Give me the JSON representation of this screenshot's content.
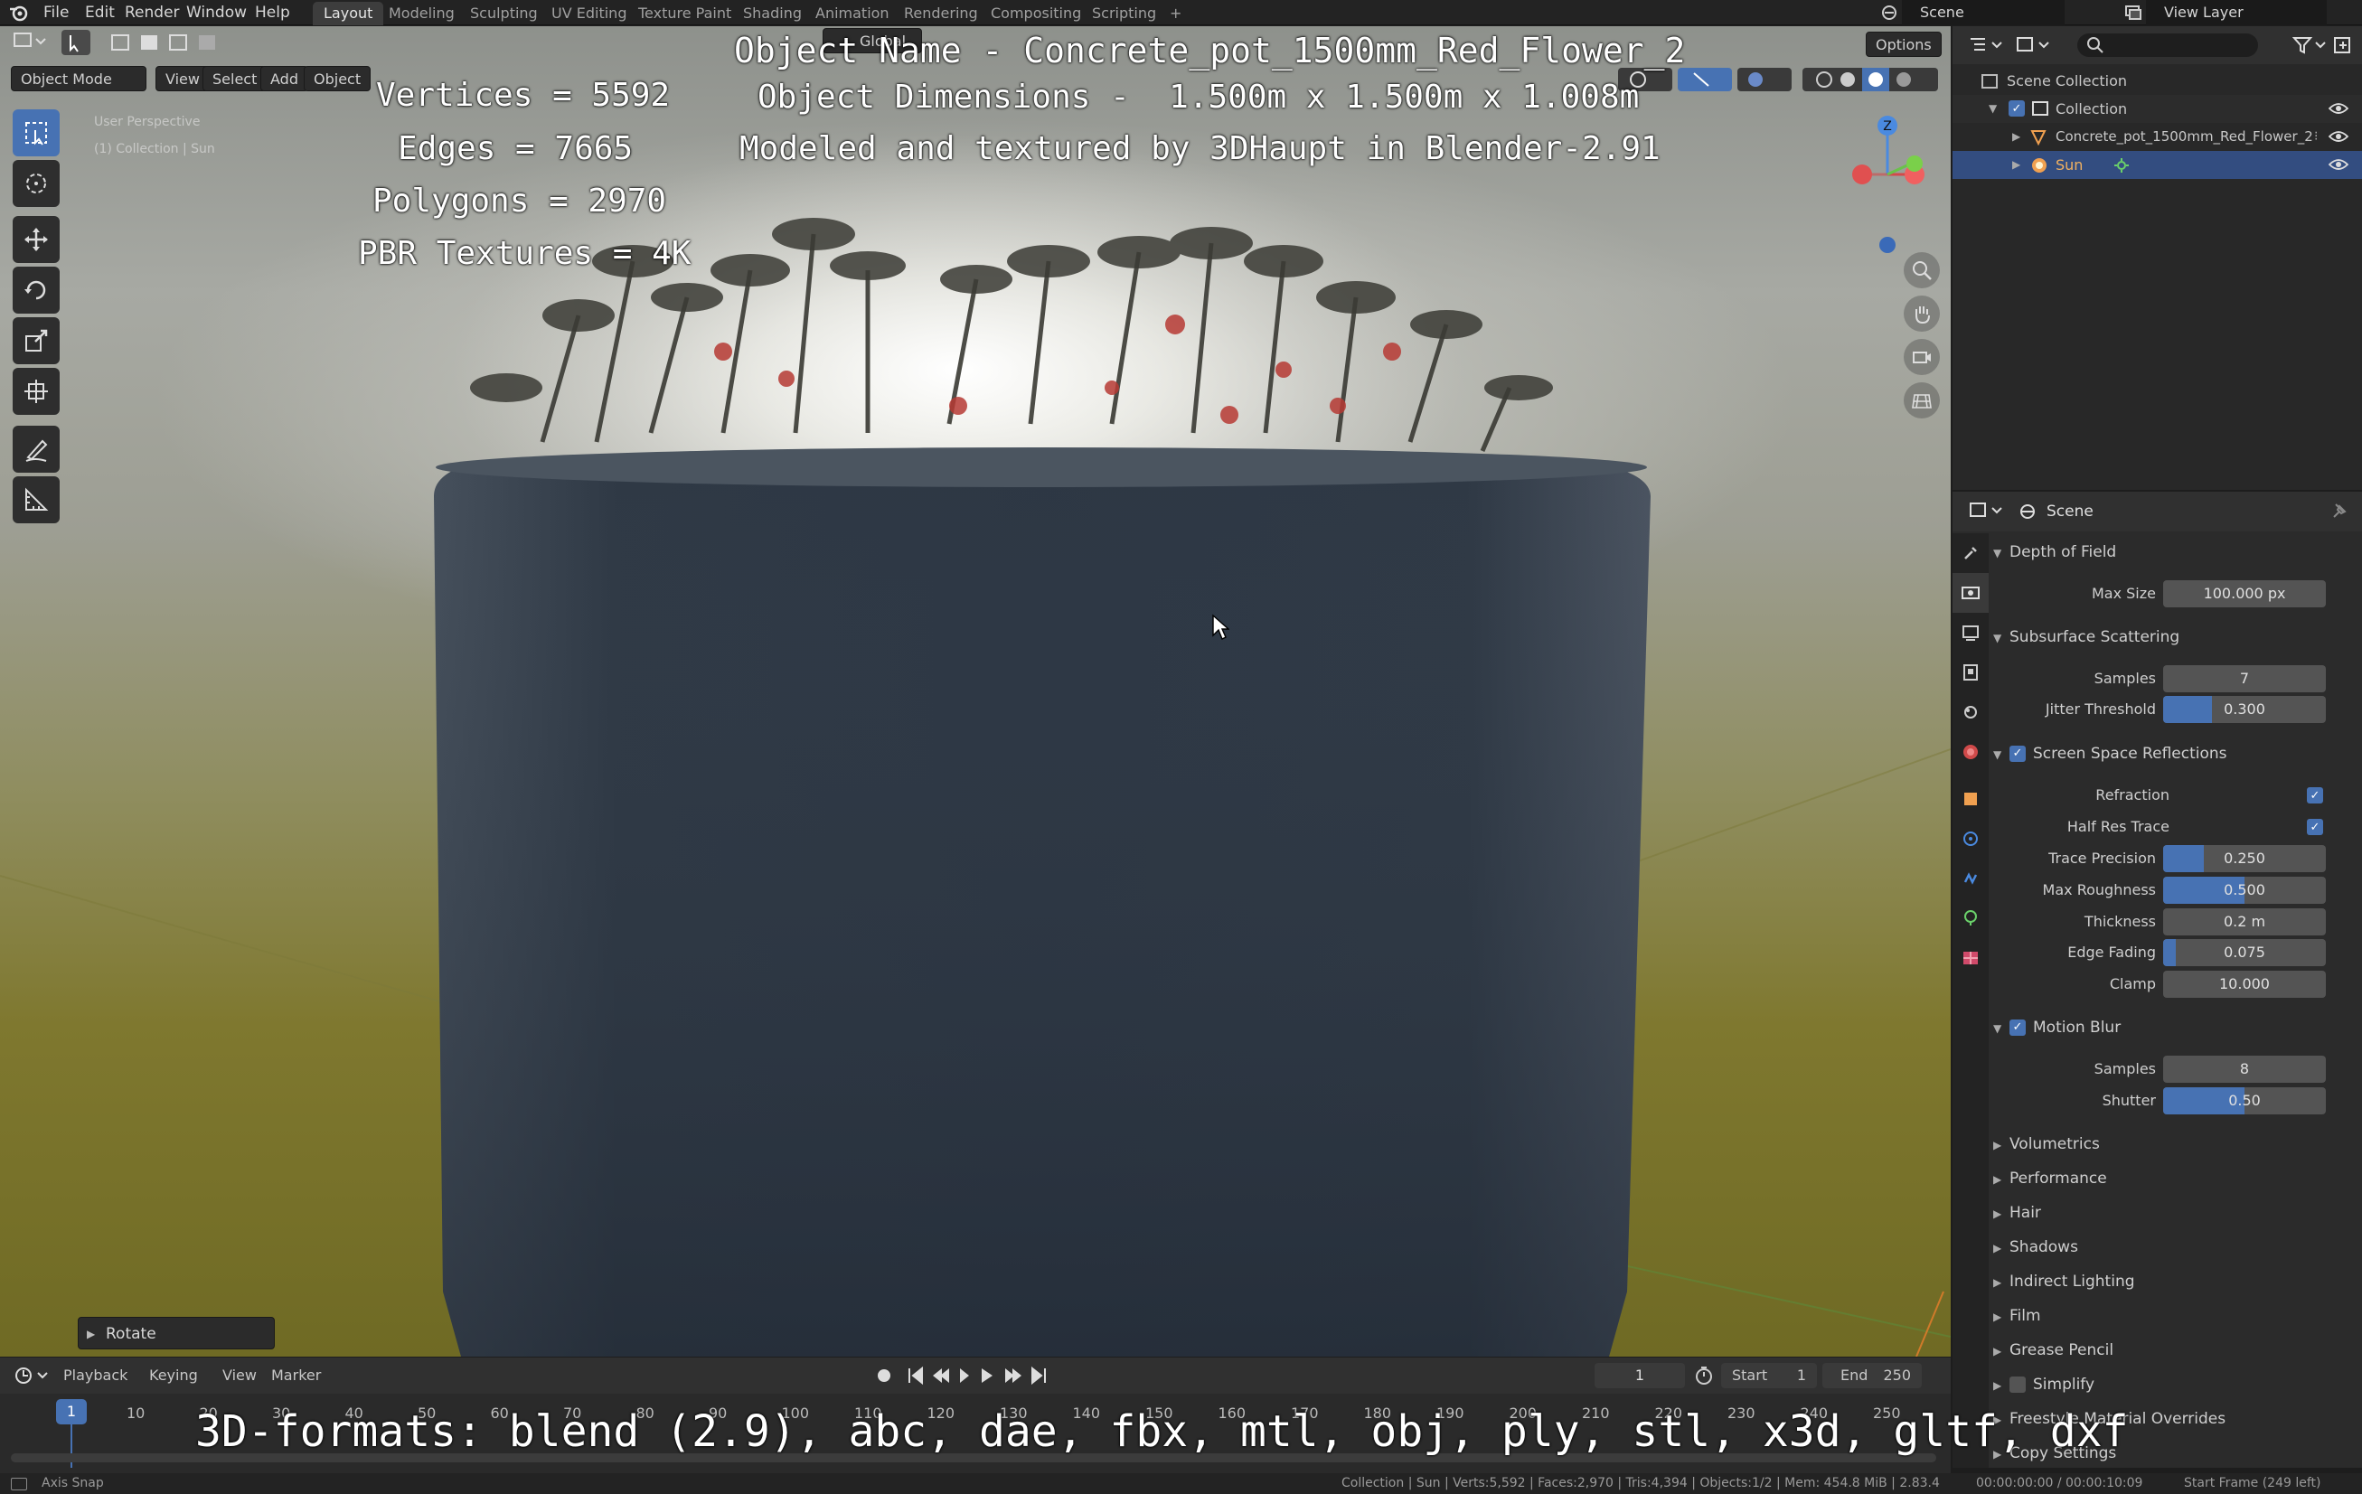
{
  "topbar": {
    "menus": [
      "File",
      "Edit",
      "Render",
      "Window",
      "Help"
    ],
    "workspaces": [
      "Layout",
      "Modeling",
      "Sculpting",
      "UV Editing",
      "Texture Paint",
      "Shading",
      "Animation",
      "Rendering",
      "Compositing",
      "Scripting"
    ],
    "active_workspace": "Layout",
    "add_tab": "+",
    "scene": "Scene",
    "view_layer": "View Layer"
  },
  "viewport_header": {
    "mode": "Object Mode",
    "menus": [
      "View",
      "Select",
      "Add",
      "Object"
    ],
    "orientation": "Global",
    "options": "Options",
    "perspective_label": "User Perspective",
    "collection_label": "(1) Collection | Sun"
  },
  "overlay": {
    "object_name": "Object Name - Concrete_pot_1500mm_Red_Flower_2",
    "dimensions": "Object Dimensions -  1.500m x 1.500m x 1.008m",
    "credits": "Modeled and textured by 3DHaupt in Blender-2.91",
    "vertices": "Vertices = 5592",
    "edges": "Edges = 7665",
    "polygons": "Polygons = 2970",
    "textures": "PBR Textures = 4K",
    "formats": "3D-formats: blend (2.9), abc, dae, fbx, mtl, obj, ply, stl, x3d, gltf, dxf"
  },
  "gizmo": {
    "axis_z": "Z"
  },
  "rotate_panel": "Rotate",
  "outliner": {
    "root": "Scene Collection",
    "items": [
      {
        "name": "Collection"
      },
      {
        "name": "Concrete_pot_1500mm_Red_Flower_2"
      },
      {
        "name": "Sun"
      }
    ]
  },
  "properties": {
    "title": "Scene",
    "sections": {
      "dof": {
        "label": "Depth of Field",
        "max_size_label": "Max Size",
        "max_size": "100.000 px"
      },
      "sss": {
        "label": "Subsurface Scattering",
        "samples_label": "Samples",
        "samples": "7",
        "jitter_label": "Jitter Threshold",
        "jitter": "0.300"
      },
      "ssr": {
        "label": "Screen Space Reflections",
        "refraction_label": "Refraction",
        "half_res_label": "Half Res Trace",
        "trace_precision_label": "Trace Precision",
        "trace_precision": "0.250",
        "max_roughness_label": "Max Roughness",
        "max_roughness": "0.500",
        "thickness_label": "Thickness",
        "thickness": "0.2 m",
        "edge_fading_label": "Edge Fading",
        "edge_fading": "0.075",
        "clamp_label": "Clamp",
        "clamp": "10.000"
      },
      "mb": {
        "label": "Motion Blur",
        "samples_label": "Samples",
        "samples": "8",
        "shutter_label": "Shutter",
        "shutter": "0.50"
      },
      "collapsed": [
        "Volumetrics",
        "Performance",
        "Hair",
        "Shadows",
        "Indirect Lighting",
        "Film",
        "Grease Pencil",
        "Simplify",
        "Freestyle Material Overrides",
        "Copy Settings"
      ]
    }
  },
  "slider_levels": {
    "jitter": 0.3,
    "trace_precision": 0.25,
    "max_roughness": 0.5,
    "edge_fading": 0.075,
    "shutter": 0.5
  },
  "timeline": {
    "menus": [
      "Playback",
      "Keying",
      "View",
      "Marker"
    ],
    "current_frame": "1",
    "start_label": "Start",
    "start": "1",
    "end_label": "End",
    "end": "250",
    "ticks": [
      "10",
      "20",
      "30",
      "40",
      "50",
      "60",
      "70",
      "80",
      "90",
      "100",
      "110",
      "120",
      "130",
      "140",
      "150",
      "160",
      "170",
      "180",
      "190",
      "200",
      "210",
      "220",
      "230",
      "240",
      "250"
    ],
    "cursor": "1"
  },
  "statusbar": {
    "hint": "Axis Snap",
    "stats": "Collection | Sun | Verts:5,592 | Faces:2,970 | Tris:4,394 | Objects:1/2 | Mem: 454.8 MiB | 2.83.4",
    "time": "00:00:00:00 / 00:00:10:09",
    "start_frame": "Start Frame (249 left)"
  }
}
